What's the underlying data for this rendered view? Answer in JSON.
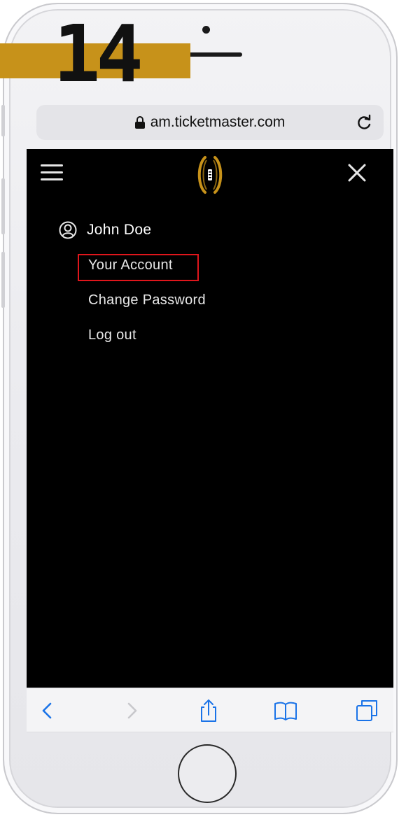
{
  "step": {
    "number": "14",
    "badge_color": "#c7921a"
  },
  "browser": {
    "url": "am.ticketmaster.com",
    "lock_icon": "lock-icon",
    "reload_icon": "reload-icon"
  },
  "header": {
    "menu_icon": "hamburger-menu-icon",
    "logo_icon": "football-logo-icon",
    "close_icon": "close-icon",
    "logo_color": "#c7921a"
  },
  "account_menu": {
    "user_name": "John Doe",
    "user_icon": "user-circle-icon",
    "items": [
      {
        "label": "Your Account",
        "highlighted": true
      },
      {
        "label": "Change Password",
        "highlighted": false
      },
      {
        "label": "Log out",
        "highlighted": false
      }
    ],
    "highlight_color": "#e0161c"
  },
  "toolbar": {
    "items": [
      {
        "icon": "chevron-left-icon",
        "enabled": true
      },
      {
        "icon": "chevron-right-icon",
        "enabled": false
      },
      {
        "icon": "share-icon",
        "enabled": true
      },
      {
        "icon": "book-icon",
        "enabled": true
      },
      {
        "icon": "tabs-icon",
        "enabled": true
      }
    ],
    "accent_color": "#1a73e8"
  }
}
